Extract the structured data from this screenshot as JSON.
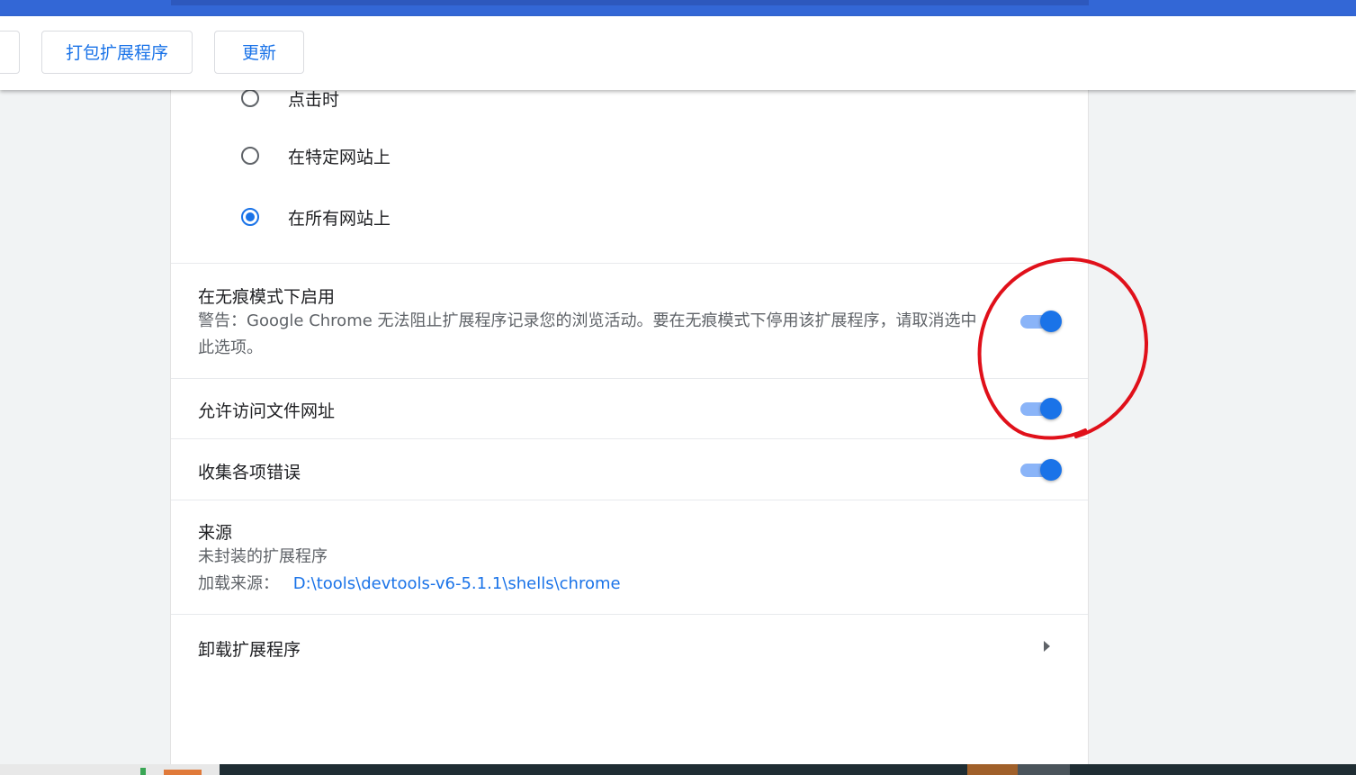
{
  "toolbar": {
    "pack_label": "打包扩展程序",
    "update_label": "更新"
  },
  "site_access": {
    "options": [
      {
        "label": "点击时",
        "checked": false
      },
      {
        "label": "在特定网站上",
        "checked": false
      },
      {
        "label": "在所有网站上",
        "checked": true
      }
    ]
  },
  "incognito": {
    "title": "在无痕模式下启用",
    "warning": "警告：Google Chrome 无法阻止扩展程序记录您的浏览活动。要在无痕模式下停用该扩展程序，请取消选中此选项。",
    "enabled": true
  },
  "file_urls": {
    "title": "允许访问文件网址",
    "enabled": true
  },
  "collect_errors": {
    "title": "收集各项错误",
    "enabled": true
  },
  "source": {
    "title": "来源",
    "type": "未封装的扩展程序",
    "load_label": "加载来源：",
    "load_path": "D:\\tools\\devtools-v6-5.1.1\\shells\\chrome"
  },
  "remove": {
    "label": "卸载扩展程序"
  },
  "colors": {
    "accent": "#1a73e8",
    "toggle_track": "#8ab4f8",
    "annotation": "#e0101a"
  },
  "icons": {
    "remove_chevron": "arrow-right-icon"
  }
}
